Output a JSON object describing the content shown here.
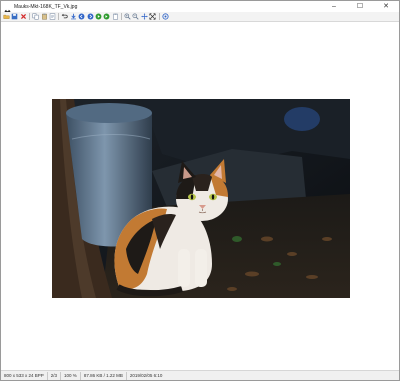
{
  "window": {
    "title": "Mauks-Mkt-168K_TF_Vk.jpg",
    "controls": {
      "minimize": "–",
      "maximize": "☐",
      "close": "✕"
    }
  },
  "toolbar": {
    "buttons": [
      {
        "name": "open-folder-icon",
        "color": "#e8b64a"
      },
      {
        "name": "save-icon",
        "color": "#3a6fc4"
      },
      {
        "name": "delete-icon",
        "color": "#d42a2a"
      },
      {
        "name": "copy-icon",
        "color": "#7e8fa6"
      },
      {
        "name": "paste-icon",
        "color": "#7e8fa6"
      },
      {
        "name": "properties-icon",
        "color": "#7e8fa6"
      },
      {
        "name": "undo-icon",
        "color": "#333333"
      },
      {
        "name": "download-icon",
        "color": "#2f64c8"
      },
      {
        "name": "previous-icon",
        "color": "#2f64c8"
      },
      {
        "name": "next-icon",
        "color": "#2f64c8"
      },
      {
        "name": "play-icon",
        "color": "#2f9b2f"
      },
      {
        "name": "play-alt-icon",
        "color": "#2f9b2f"
      },
      {
        "name": "clipboard-icon",
        "color": "#7e8fa6"
      },
      {
        "name": "zoom-in-icon",
        "color": "#6a7c93"
      },
      {
        "name": "zoom-out-icon",
        "color": "#6a7c93"
      },
      {
        "name": "move-icon",
        "color": "#2f64c8"
      },
      {
        "name": "fit-window-icon",
        "color": "#333333"
      },
      {
        "name": "info-icon",
        "color": "#2f64c8"
      }
    ]
  },
  "statusbar": {
    "dimensions": "800 x 533 x 24 BPP",
    "index": "2/3",
    "zoom": "100 %",
    "filesize": "87.86 KB / 1.22 MB",
    "datetime": "2019/02/05 6:10"
  },
  "colors": {
    "toolbar_bg": "#f3f3f3",
    "status_bg": "#f0f0f0"
  }
}
